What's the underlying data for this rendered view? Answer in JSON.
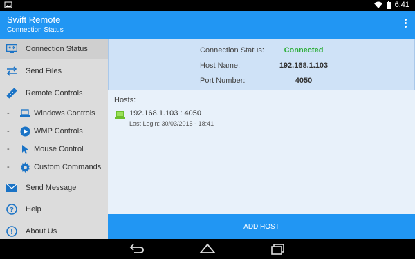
{
  "status_bar": {
    "time": "6:41"
  },
  "app": {
    "title": "Swift Remote",
    "subtitle": "Connection Status"
  },
  "sidebar": {
    "items": [
      {
        "label": "Connection Status",
        "icon": "monitor-connection-icon"
      },
      {
        "label": "Send Files",
        "icon": "transfer-arrows-icon"
      },
      {
        "label": "Remote Controls",
        "icon": "remote-icon"
      },
      {
        "label": "Windows Controls",
        "icon": "laptop-icon",
        "sub": true
      },
      {
        "label": "WMP Controls",
        "icon": "play-icon",
        "sub": true
      },
      {
        "label": "Mouse Control",
        "icon": "mouse-icon",
        "sub": true
      },
      {
        "label": "Custom Commands",
        "icon": "gear-icon",
        "sub": true
      },
      {
        "label": "Send Message",
        "icon": "envelope-icon"
      },
      {
        "label": "Help",
        "icon": "question-icon"
      },
      {
        "label": "About Us",
        "icon": "info-icon"
      }
    ],
    "dash": "-"
  },
  "status": {
    "connection_label": "Connection Status:",
    "connection_value": "Connected",
    "host_label": "Host Name:",
    "host_value": "192.168.1.103",
    "port_label": "Port Number:",
    "port_value": "4050"
  },
  "hosts": {
    "label": "Hosts:",
    "items": [
      {
        "address": "192.168.1.103 : 4050",
        "last_login": "Last Login: 30/03/2015 - 18:41"
      }
    ]
  },
  "add_host_button": "ADD HOST",
  "colors": {
    "accent": "#2196F3",
    "connected": "#2eae3a",
    "sidebar": "#dcdcdc",
    "panel": "#cfe2f7"
  }
}
